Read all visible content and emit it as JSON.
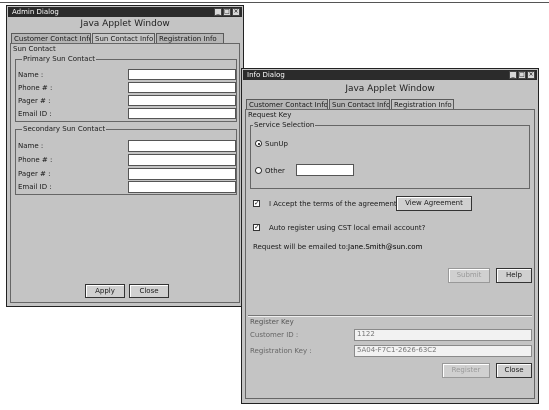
{
  "admin_window": {
    "title": "Admin Dialog",
    "controls": [
      "_",
      "□",
      "×"
    ],
    "applet_title": "Java Applet Window",
    "tabs": [
      {
        "label": "Customer Contact Info",
        "active": false
      },
      {
        "label": "Sun Contact Info",
        "active": true
      },
      {
        "label": "Registration Info",
        "active": false
      }
    ],
    "panel_title": "Sun Contact",
    "primary": {
      "legend": "Primary Sun Contact",
      "labels": [
        "Name :",
        "Phone # :",
        "Pager # :",
        "Email ID :"
      ]
    },
    "secondary": {
      "legend": "Secondary Sun Contact",
      "labels": [
        "Name :",
        "Phone # :",
        "Pager # :",
        "Email ID :"
      ]
    },
    "apply_label": "Apply",
    "close_label": "Close"
  },
  "info_window": {
    "title": "Info Dialog",
    "controls": [
      "_",
      "□",
      "×"
    ],
    "applet_title": "Java Applet Window",
    "tabs": [
      {
        "label": "Customer Contact Info",
        "active": false
      },
      {
        "label": "Sun Contact Info",
        "active": false
      },
      {
        "label": "Registration Info",
        "active": true
      }
    ],
    "request_key": {
      "legend": "Request Key",
      "service_selection": {
        "legend": "Service Selection",
        "options": [
          {
            "label": "SunUp",
            "selected": true
          },
          {
            "label": "Other",
            "selected": false
          }
        ],
        "other_value": ""
      },
      "accept_terms": {
        "label": "I Accept the terms of the agreement",
        "checked": true
      },
      "view_agreement_label": "View Agreement",
      "auto_register": {
        "label": "Auto register using CST local email account?",
        "checked": true
      },
      "email_prefix": "Request will be emailed to:",
      "email_address": "Jane.Smith@sun.com",
      "submit_label": "Submit",
      "help_label": "Help"
    },
    "register_key": {
      "legend": "Register Key",
      "customer_id_label": "Customer ID :",
      "customer_id_value": "1122",
      "registration_key_label": "Registration Key :",
      "registration_key_value": "5A04-F7C1-2626-63C2",
      "register_label": "Register",
      "close_label": "Close"
    }
  },
  "colors": {
    "titlebar": "#2b2b2b",
    "window_bg": "#c4c4c4",
    "field_bg": "#ffffff"
  }
}
